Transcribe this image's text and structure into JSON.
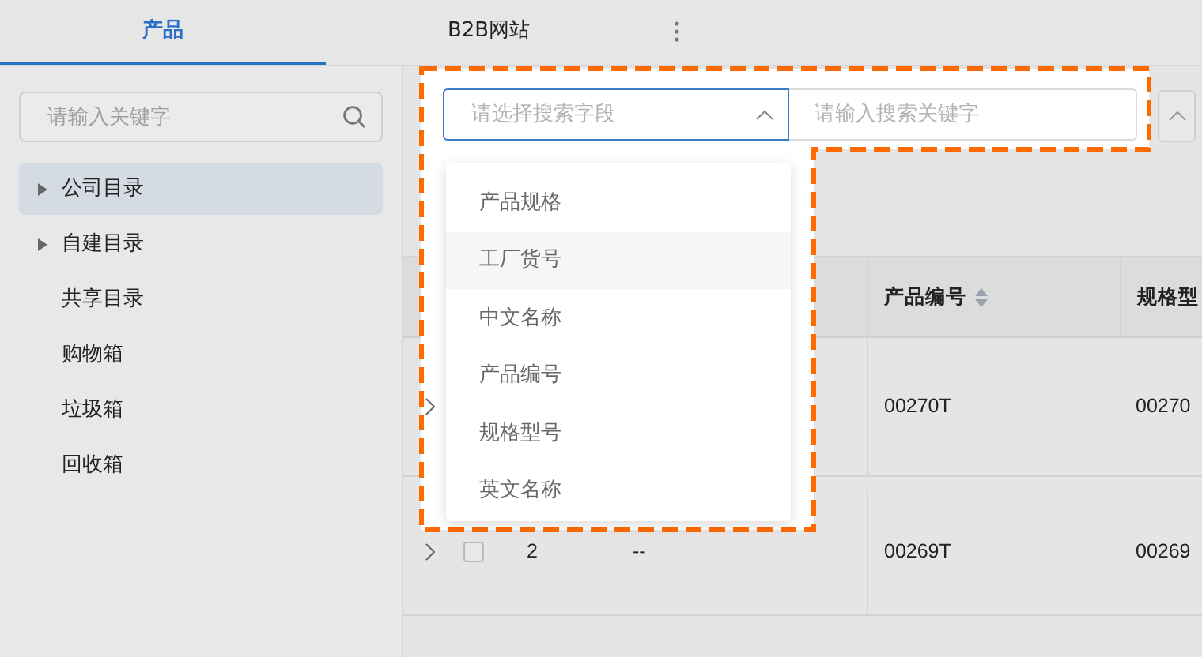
{
  "tabs": [
    {
      "label": "产品",
      "selected": true
    },
    {
      "label": "B2B网站",
      "selected": false
    }
  ],
  "sidebar": {
    "search": {
      "placeholder": "请输入关键字"
    },
    "items": [
      {
        "label": "公司目录",
        "expandable": true,
        "selected": true
      },
      {
        "label": "自建目录",
        "expandable": true,
        "selected": false
      },
      {
        "label": "共享目录",
        "expandable": false,
        "selected": false
      },
      {
        "label": "购物箱",
        "expandable": false,
        "selected": false
      },
      {
        "label": "垃圾箱",
        "expandable": false,
        "selected": false
      },
      {
        "label": "回收箱",
        "expandable": false,
        "selected": false
      }
    ]
  },
  "search_bar": {
    "field_select": {
      "placeholder": "请选择搜索字段",
      "expanded": true
    },
    "keyword": {
      "placeholder": "请输入搜索关键字"
    },
    "options": [
      {
        "label": "产品规格",
        "hovered": false
      },
      {
        "label": "工厂货号",
        "hovered": true
      },
      {
        "label": "中文名称",
        "hovered": false
      },
      {
        "label": "产品编号",
        "hovered": false
      },
      {
        "label": "规格型号",
        "hovered": false
      },
      {
        "label": "英文名称",
        "hovered": false
      }
    ]
  },
  "table": {
    "columns": [
      {
        "label": "产品编号",
        "sortable": true
      },
      {
        "label": "规格型"
      }
    ],
    "rows": [
      {
        "checked": null,
        "index": "",
        "column_4": "",
        "product_no": "00270T",
        "spec": "00270"
      },
      {
        "checked": false,
        "index": "2",
        "column_4": "--",
        "product_no": "00269T",
        "spec": "00269"
      }
    ]
  }
}
